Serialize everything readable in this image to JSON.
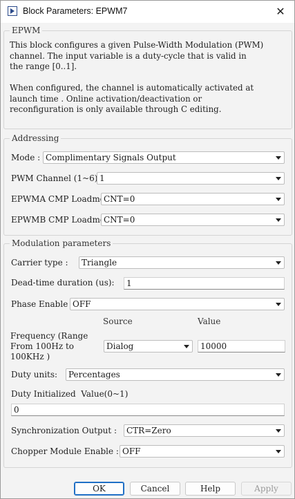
{
  "window": {
    "title": "Block Parameters: EPWM7",
    "close_icon": "close-icon"
  },
  "epwm": {
    "legend": "EPWM",
    "description": "This block configures a given Pulse-Width Modulation (PWM)\nchannel. The input variable is a duty-cycle that is valid in\nthe range [0..1].\n\nWhen configured, the channel is automatically activated at\nlaunch time . Online activation/deactivation or\nreconfiguration is only available through C editing."
  },
  "addressing": {
    "legend": "Addressing",
    "mode_label": "Mode :",
    "mode_value": "Complimentary Signals Output",
    "pwm_channel_label": "PWM Channel (1~6):",
    "pwm_channel_value": "1",
    "epwma_label": "EPWMA CMP Loadmode:",
    "epwma_value": "CNT=0",
    "epwmb_label": "EPWMB CMP Loadmode:",
    "epwmb_value": "CNT=0"
  },
  "modulation": {
    "legend": "Modulation parameters",
    "carrier_label": "Carrier type :",
    "carrier_value": "Triangle",
    "deadtime_label": "Dead-time duration (us):",
    "deadtime_value": "1",
    "phase_label": "Phase Enable",
    "phase_value": "OFF",
    "source_header": "Source",
    "value_header": "Value",
    "frequency_label_1": "Frequency (Range",
    "frequency_label_2": "From 100Hz to",
    "frequency_label_3": "100KHz )",
    "frequency_source": "Dialog",
    "frequency_value": "10000",
    "duty_units_label": "Duty units:",
    "duty_units_value": "Percentages",
    "duty_init_label": "Duty Initialized  Value(0~1)",
    "duty_init_value": "0",
    "sync_label": "Synchronization Output :",
    "sync_value": "CTR=Zero",
    "chopper_label": "Chopper Module Enable :",
    "chopper_value": "OFF"
  },
  "buttons": {
    "ok": "OK",
    "cancel": "Cancel",
    "help": "Help",
    "apply": "Apply"
  }
}
